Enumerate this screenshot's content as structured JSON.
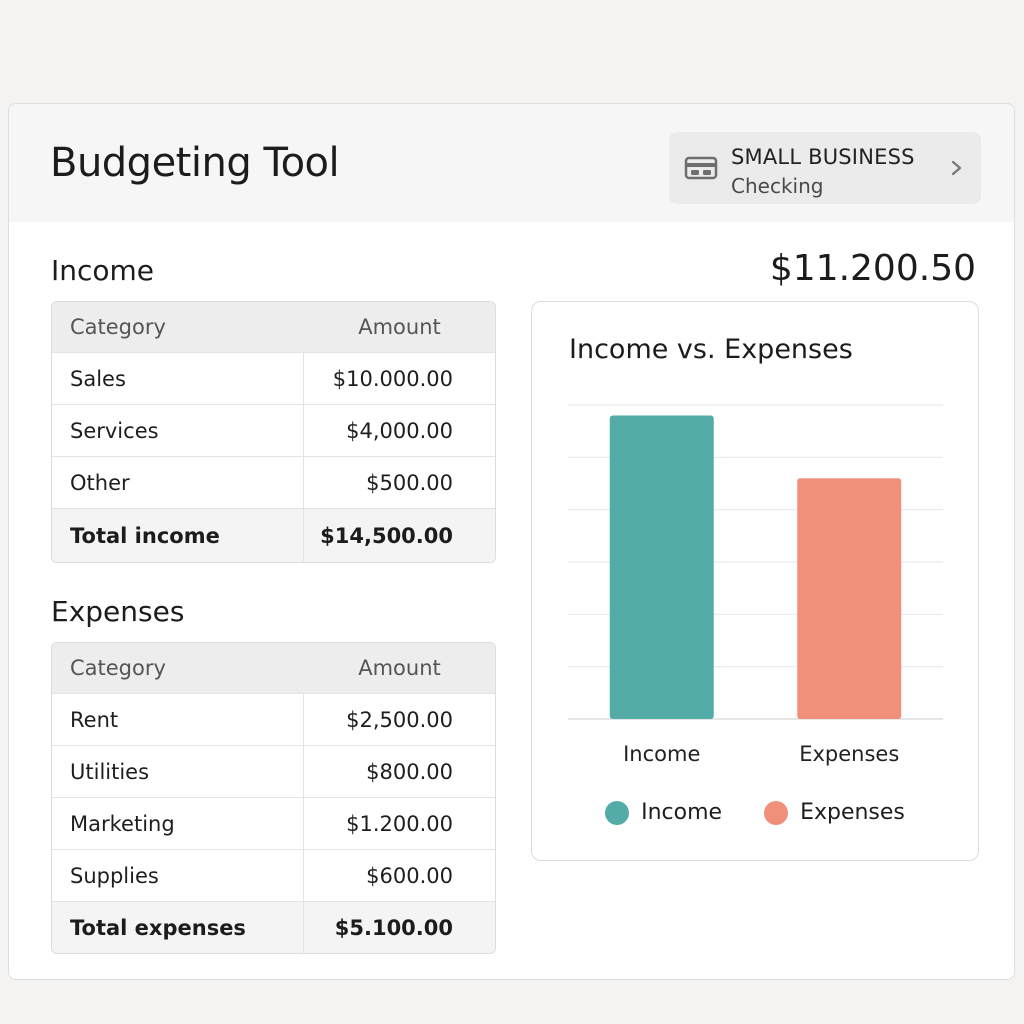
{
  "app": {
    "title": "Budgeting Tool"
  },
  "account": {
    "name": "SMALL BUSINESS",
    "type": "Checking",
    "icon": "bank-card-icon"
  },
  "net_total": "$11.200.50",
  "income": {
    "title": "Income",
    "headers": {
      "category": "Category",
      "amount": "Amount"
    },
    "rows": [
      {
        "category": "Sales",
        "amount": "$10.000.00"
      },
      {
        "category": "Services",
        "amount": "$4,000.00"
      },
      {
        "category": "Other",
        "amount": "$500.00"
      }
    ],
    "total": {
      "label": "Total income",
      "amount": "$14,500.00"
    }
  },
  "expenses": {
    "title": "Expenses",
    "headers": {
      "category": "Category",
      "amount": "Amount"
    },
    "rows": [
      {
        "category": "Rent",
        "amount": "$2,500.00"
      },
      {
        "category": "Utilities",
        "amount": "$800.00"
      },
      {
        "category": "Marketing",
        "amount": "$1.200.00"
      },
      {
        "category": "Supplies",
        "amount": "$600.00"
      }
    ],
    "total": {
      "label": "Total expenses",
      "amount": "$5.100.00"
    }
  },
  "colors": {
    "income": "#53aca8",
    "expenses": "#f0907a"
  },
  "chart_data": {
    "type": "bar",
    "title": "Income vs. Expenses",
    "categories": [
      "Income",
      "Expenses"
    ],
    "values": [
      14500,
      11500
    ],
    "ylim": [
      0,
      15000
    ],
    "grid": true,
    "legend": {
      "placement": "bottom",
      "entries": [
        "Income",
        "Expenses"
      ]
    }
  }
}
